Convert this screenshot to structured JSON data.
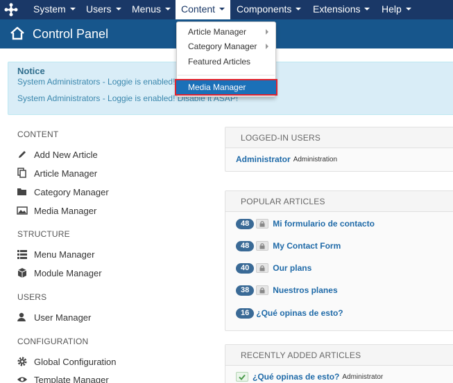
{
  "nav": {
    "items": [
      "System",
      "Users",
      "Menus",
      "Content",
      "Components",
      "Extensions",
      "Help"
    ],
    "active": "Content"
  },
  "header": {
    "title": "Control Panel"
  },
  "notice": {
    "title": "Notice",
    "message_1": "System Administrators - Loggie is enabled! Disable it ASAP!",
    "message_2": "System Administrators - Loggie is enabled! Disable it ASAP!"
  },
  "dropdown": {
    "items": [
      "Article Manager",
      "Category Manager",
      "Featured Articles"
    ],
    "highlighted": "Media Manager"
  },
  "sidebar": {
    "content": {
      "heading": "CONTENT",
      "items": [
        "Add New Article",
        "Article Manager",
        "Category Manager",
        "Media Manager"
      ]
    },
    "structure": {
      "heading": "STRUCTURE",
      "items": [
        "Menu Manager",
        "Module Manager"
      ]
    },
    "users": {
      "heading": "USERS",
      "items": [
        "User Manager"
      ]
    },
    "configuration": {
      "heading": "CONFIGURATION",
      "items": [
        "Global Configuration",
        "Template Manager"
      ]
    }
  },
  "logged_in": {
    "heading": "LOGGED-IN USERS",
    "user": "Administrator",
    "location": "Administration"
  },
  "popular": {
    "heading": "POPULAR ARTICLES",
    "items": [
      {
        "hits": "48",
        "title": "Mi formulario de contacto",
        "locked": true
      },
      {
        "hits": "48",
        "title": "My Contact Form",
        "locked": true
      },
      {
        "hits": "40",
        "title": "Our plans",
        "locked": true
      },
      {
        "hits": "38",
        "title": "Nuestros planes",
        "locked": true
      },
      {
        "hits": "16",
        "title": "¿Qué opinas de esto?",
        "locked": false
      }
    ]
  },
  "recent": {
    "heading": "RECENTLY ADDED ARTICLES",
    "items": [
      {
        "title": "¿Qué opinas de esto?",
        "author": "Administrator"
      }
    ]
  },
  "colors": {
    "navbar": "#1a3867",
    "header": "#17568c",
    "notice_bg": "#d9edf7",
    "link": "#1f6aa8",
    "badge": "#3a6a96",
    "highlight": "#1b70b8",
    "highlight_border": "#e0222d"
  }
}
